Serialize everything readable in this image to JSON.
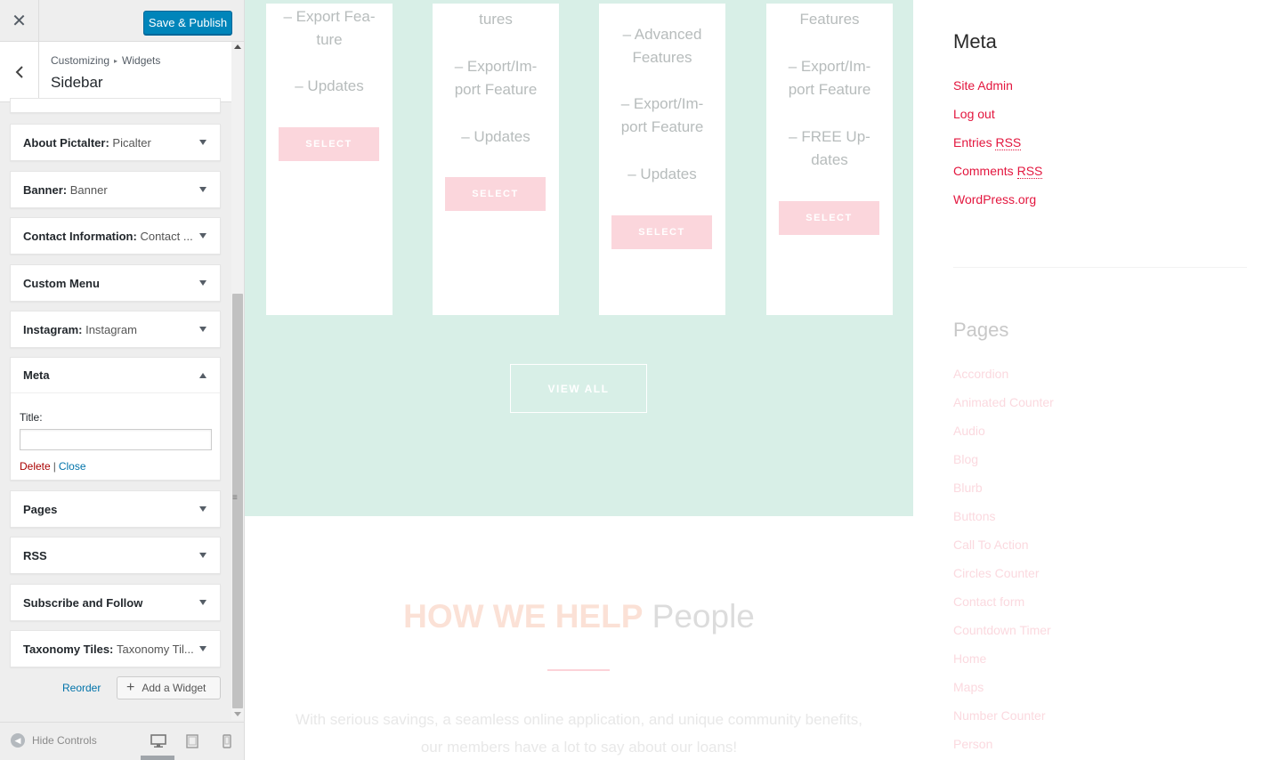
{
  "customizer": {
    "close_glyph": "✕",
    "publish_label": "Save & Publish",
    "breadcrumb": {
      "root": "Customizing",
      "separator": "▸",
      "current": "Widgets"
    },
    "section_title": "Sidebar",
    "widgets": [
      {
        "title": "About Pictalter:",
        "subtitle": "Picalter",
        "state": "collapsed"
      },
      {
        "title": "Banner:",
        "subtitle": "Banner",
        "state": "collapsed"
      },
      {
        "title": "Contact Information:",
        "subtitle": "Contact ...",
        "state": "collapsed"
      },
      {
        "title": "Custom Menu",
        "subtitle": "",
        "state": "collapsed"
      },
      {
        "title": "Instagram:",
        "subtitle": "Instagram",
        "state": "collapsed"
      },
      {
        "title": "Meta",
        "subtitle": "",
        "state": "expanded",
        "field_label": "Title:",
        "field_value": "",
        "delete_label": "Delete",
        "separator": "|",
        "close_label": "Close"
      },
      {
        "title": "Pages",
        "subtitle": "",
        "state": "collapsed"
      },
      {
        "title": "RSS",
        "subtitle": "",
        "state": "collapsed"
      },
      {
        "title": "Subscribe and Follow",
        "subtitle": "",
        "state": "collapsed"
      },
      {
        "title": "Taxonomy Tiles:",
        "subtitle": "Taxonomy Til...",
        "state": "collapsed"
      }
    ],
    "reorder_label": "Reorder",
    "add_widget_label": "Add a Widget",
    "add_widget_glyph": "+",
    "hide_controls_label": "Hide Controls",
    "preview_device": "desktop",
    "accent_color": "#0085ba"
  },
  "preview": {
    "pricing_cards": [
      {
        "features": [
          "– Export Fea-",
          "ture",
          "",
          "– Updates"
        ],
        "button": "SELECT"
      },
      {
        "features": [
          "tures",
          "",
          "– Export/Im-",
          "port Feature",
          "",
          "– Updates"
        ],
        "button": "SELECT"
      },
      {
        "features": [
          "– Advanced",
          "Features",
          "",
          "– Export/Im-",
          "port Feature",
          "",
          "– Updates"
        ],
        "button": "SELECT"
      },
      {
        "features": [
          "Features",
          "",
          "– Export/Im-",
          "port Feature",
          "",
          "– FREE Up-",
          "dates"
        ],
        "button": "SELECT"
      }
    ],
    "view_all_label": "VIEW ALL",
    "help_heading_highlight": "HOW WE HELP",
    "help_heading_rest": "People",
    "help_text_line1": "With serious savings, a seamless online application, and unique community benefits,",
    "help_text_line2": "our members have a lot to say about our loans!",
    "sidebar": {
      "meta_heading": "Meta",
      "meta_links": [
        "Site Admin",
        "Log out",
        "Entries",
        "Comments",
        "WordPress.org"
      ],
      "rss_abbr": "RSS",
      "pages_heading": "Pages",
      "pages_links": [
        "Accordion",
        "Animated Counter",
        "Audio",
        "Blog",
        "Blurb",
        "Buttons",
        "Call To Action",
        "Circles Counter",
        "Contact form",
        "Countdown Timer",
        "Home",
        "Maps",
        "Number Counter",
        "Person"
      ]
    },
    "colors": {
      "mint": "#d8efe7",
      "pink_accent": "#e3163e",
      "button_pink": "#fbd6dc"
    }
  }
}
